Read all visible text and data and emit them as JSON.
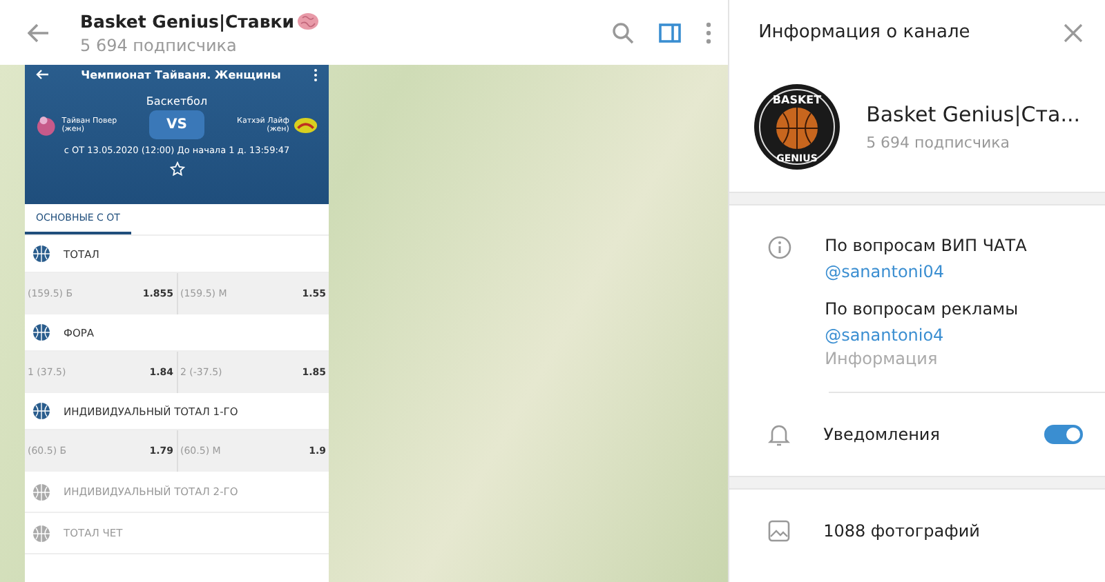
{
  "chat_header": {
    "title": "Basket Genius|Ставки",
    "subtitle": "5 694 подписчика",
    "side_panel_open": true
  },
  "message_image": {
    "app_title": "Чемпионат Тайваня. Женщины",
    "sport": "Баскетбол",
    "team_1": "Тайван Повер (жен)",
    "team_2": "Катхэй Лайф (жен)",
    "vs": "VS",
    "date_line": "с ОТ 13.05.2020 (12:00)  До начала 1 д. 13:59:47",
    "tabs": [
      {
        "label": "ОСНОВНЫЕ С ОТ",
        "selected": true
      }
    ],
    "markets": [
      {
        "title": "ТОТАЛ",
        "expanded": true,
        "outcomes": [
          {
            "label": "(159.5) Б",
            "odds": "1.855"
          },
          {
            "label": "(159.5) М",
            "odds": "1.55"
          }
        ]
      },
      {
        "title": "ФОРА",
        "expanded": true,
        "outcomes": [
          {
            "label": "1 (37.5)",
            "odds": "1.84"
          },
          {
            "label": "2 (-37.5)",
            "odds": "1.85"
          }
        ]
      },
      {
        "title": "ИНДИВИДУАЛЬНЫЙ ТОТАЛ 1-ГО",
        "expanded": true,
        "outcomes": [
          {
            "label": "(60.5) Б",
            "odds": "1.79"
          },
          {
            "label": "(60.5) М",
            "odds": "1.9"
          }
        ]
      },
      {
        "title": "ИНДИВИДУАЛЬНЫЙ ТОТАЛ 2-ГО",
        "expanded": false
      },
      {
        "title": "ТОТАЛ ЧЕТ",
        "expanded": false
      }
    ]
  },
  "info_panel": {
    "title": "Информация о канале",
    "logo_words": [
      "BASKET",
      "GENIUS"
    ],
    "channel_name": "Basket Genius|Ста...",
    "subscribers": "5 694 подписчика",
    "contacts": [
      {
        "text": "По вопросам ВИП ЧАТА",
        "link": "@sanantoni04"
      },
      {
        "text": "По вопросам рекламы",
        "link": "@sanantonio4"
      }
    ],
    "info_caption": "Информация",
    "notifications": {
      "label": "Уведомления",
      "on": true
    },
    "media": [
      {
        "label": "1088 фотографий"
      }
    ]
  }
}
